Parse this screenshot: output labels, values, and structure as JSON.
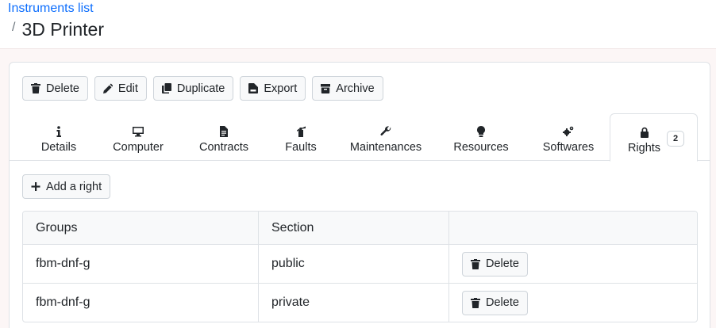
{
  "breadcrumb": {
    "parent": "Instruments list",
    "separator": "/",
    "current": "3D Printer"
  },
  "toolbar": {
    "delete_label": "Delete",
    "edit_label": "Edit",
    "duplicate_label": "Duplicate",
    "export_label": "Export",
    "archive_label": "Archive"
  },
  "tabs": {
    "details": "Details",
    "computer": "Computer",
    "contracts": "Contracts",
    "faults": "Faults",
    "maintenances": "Maintenances",
    "resources": "Resources",
    "softwares": "Softwares",
    "rights": "Rights",
    "rights_count": "2",
    "active": "rights"
  },
  "rights": {
    "add_label": "Add a right",
    "columns": [
      "Groups",
      "Section",
      ""
    ],
    "rows": [
      {
        "group": "fbm-dnf-g",
        "section": "public",
        "action": "Delete"
      },
      {
        "group": "fbm-dnf-g",
        "section": "private",
        "action": "Delete"
      }
    ]
  },
  "colors": {
    "link": "#0d6efd",
    "band": "#fcf6f6",
    "border": "#dee2e6"
  }
}
